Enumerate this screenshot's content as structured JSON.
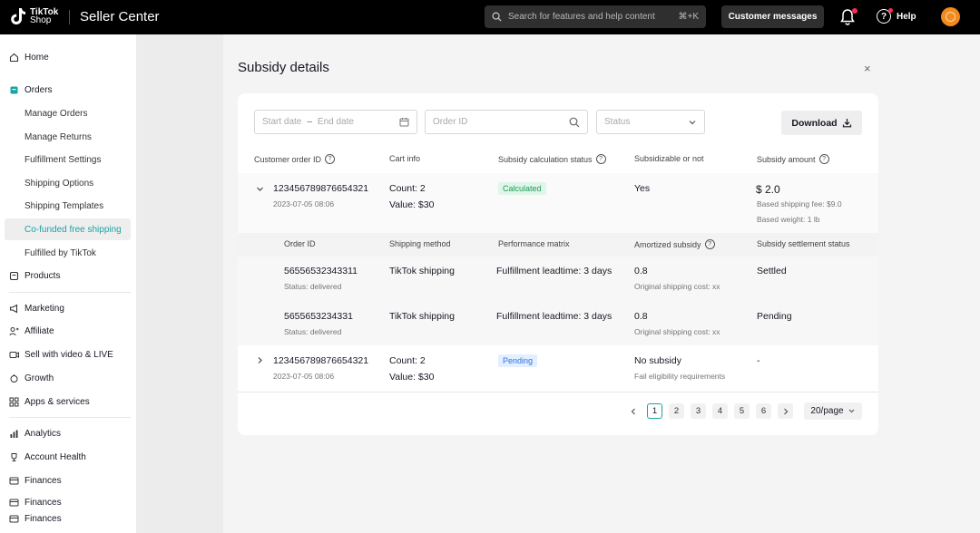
{
  "header": {
    "logo_text_1": "TikTok",
    "logo_text_2": "Shop",
    "app_title": "Seller Center",
    "search_placeholder": "Search for features and help content",
    "search_shortcut": "⌘+K",
    "customer_messages": "Customer messages",
    "help": "Help"
  },
  "sidebar": {
    "home": "Home",
    "orders": "Orders",
    "manage_orders": "Manage Orders",
    "manage_returns": "Manage Returns",
    "fulfillment_settings": "Fulfillment Settings",
    "shipping_options": "Shipping Options",
    "shipping_templates": "Shipping Templates",
    "co_funded": "Co-funded free shipping",
    "fulfilled_by_tiktok": "Fulfilled by TikTok",
    "products": "Products",
    "marketing": "Marketing",
    "affiliate": "Affiliate",
    "sell_video_live": "Sell with video & LIVE",
    "growth": "Growth",
    "apps_services": "Apps & services",
    "analytics": "Analytics",
    "account_health": "Account Health",
    "finances_1": "Finances",
    "finances_2": "Finances",
    "finances_3": "Finances"
  },
  "panel": {
    "title": "Subsidy details",
    "close": "×"
  },
  "filters": {
    "start_date": "Start date",
    "end_date": "End date",
    "date_sep": "–",
    "order_id_placeholder": "Order ID",
    "status_placeholder": "Status",
    "download": "Download"
  },
  "table": {
    "headers": {
      "customer_order_id": "Customer order ID",
      "cart_info": "Cart info",
      "calc_status": "Subsidy calculation status",
      "subsidizable": "Subsidizable or not",
      "amount": "Subsidy amount"
    },
    "rows": [
      {
        "order_id": "123456789876654321",
        "date": "2023-07-05 08:06",
        "count": "Count: 2",
        "value": "Value: $30",
        "status": "Calculated",
        "subsidizable": "Yes",
        "amount": "$ 2.0",
        "fee_note": "Based shipping fee: $9.0",
        "weight_note": "Based weight: 1 lb"
      },
      {
        "order_id": "123456789876654321",
        "date": "2023-07-05 08:06",
        "count": "Count: 2",
        "value": "Value: $30",
        "status": "Pending",
        "subsidizable": "No subsidy",
        "subsidizable_note": "Fail eligibility requirements",
        "amount": "-"
      }
    ],
    "sub_headers": {
      "order_id": "Order ID",
      "shipping_method": "Shipping method",
      "performance": "Performance matrix",
      "amortized": "Amortized subsidy",
      "settlement": "Subsidy settlement status"
    },
    "sub_rows": [
      {
        "order_id": "56556532343311",
        "status": "Status: delivered",
        "method": "TikTok shipping",
        "performance": "Fulfillment leadtime: 3 days",
        "amortized": "0.8",
        "orig_cost": "Original shipping cost: xx",
        "settlement": "Settled"
      },
      {
        "order_id": "5655653234331",
        "status": "Status: delivered",
        "method": "TikTok shipping",
        "performance": "Fulfillment leadtime: 3 days",
        "amortized": "0.8",
        "orig_cost": "Original shipping cost: xx",
        "settlement": "Pending"
      }
    ]
  },
  "pagination": {
    "pages": [
      "1",
      "2",
      "3",
      "4",
      "5",
      "6"
    ],
    "current": "1",
    "page_size": "20/page"
  },
  "colors": {
    "accent": "#1ba3a3",
    "calculated_bg": "#e0f6ea",
    "calculated_text": "#1d9a55",
    "pending_bg": "#e3efff",
    "pending_text": "#2b74e0"
  }
}
